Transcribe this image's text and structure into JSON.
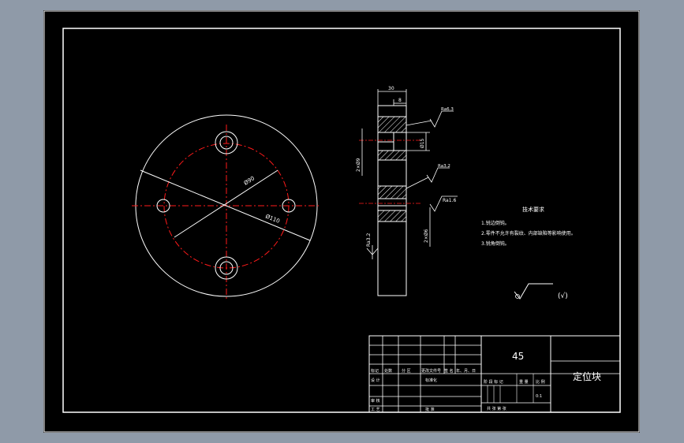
{
  "title_block": {
    "material": "45",
    "part_name": "定位块",
    "scale_value": "0:1",
    "labels": {
      "mark": "标记",
      "count": "处数",
      "zone": "分 区",
      "change_doc": "更改文件号",
      "signature": "签 名",
      "date": "年、月、日",
      "design": "设 计",
      "standardize": "标准化",
      "stage_mark": "阶 段 标 记",
      "weight": "重 量",
      "scale": "比 例",
      "review": "审 核",
      "process": "工 艺",
      "approve": "批 准",
      "sheets": "共   张   第   张"
    }
  },
  "tech_requirements": {
    "title": "技术要求",
    "items": [
      "1.锐边倒钝。",
      "2.零件不允许有裂纹、内部缺陷等影响使用。",
      "3.锐角倒钝。"
    ]
  },
  "surface_symbol": {
    "suffix": "(√)"
  },
  "dimensions": {
    "width_30": "30",
    "width_8": "8",
    "diam_15": "Ø15",
    "diam_90": "Ø90",
    "diam_110": "Ø110",
    "holes_left": "2×Ø9",
    "holes_right": "2×Ø6",
    "ra_a": "Ra6.3",
    "ra_b": "Ra3.2",
    "ra_c": "Ra1.6",
    "ra_d": "Ra3.2"
  },
  "colors": {
    "line": "#ffffff",
    "center_line": "#ff1a1a",
    "background": "#000000",
    "window": "#8f9aa8"
  }
}
